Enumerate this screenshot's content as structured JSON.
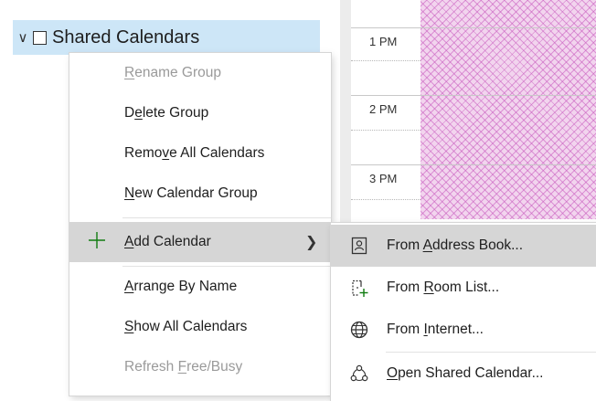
{
  "group": {
    "label": "Shared Calendars"
  },
  "times": [
    "1 PM",
    "2 PM",
    "3 PM"
  ],
  "menu": {
    "items": [
      {
        "pre": "",
        "u": "R",
        "post": "ename Group",
        "disabled": true
      },
      {
        "pre": "D",
        "u": "e",
        "post": "lete Group",
        "disabled": false
      },
      {
        "pre": "Remo",
        "u": "v",
        "post": "e All Calendars",
        "disabled": false
      },
      {
        "pre": "",
        "u": "N",
        "post": "ew Calendar Group",
        "disabled": false
      },
      {
        "pre": "",
        "u": "A",
        "post": "dd Calendar",
        "disabled": false
      },
      {
        "pre": "",
        "u": "A",
        "post": "rrange By Name",
        "disabled": false
      },
      {
        "pre": "",
        "u": "S",
        "post": "how All Calendars",
        "disabled": false
      },
      {
        "pre": "Refresh ",
        "u": "F",
        "post": "ree/Busy",
        "disabled": true
      }
    ]
  },
  "submenu": {
    "items": [
      {
        "pre": "From ",
        "u": "A",
        "post": "ddress Book..."
      },
      {
        "pre": "From ",
        "u": "R",
        "post": "oom List..."
      },
      {
        "pre": "From ",
        "u": "I",
        "post": "nternet..."
      },
      {
        "pre": "",
        "u": "O",
        "post": "pen Shared Calendar..."
      }
    ]
  },
  "colors": {
    "accent_green": "#107c10",
    "highlight": "#d6d6d6",
    "selected_group": "#cde6f7",
    "busy_pattern": "#c85abe"
  },
  "icons": {
    "expand": "chevron-down-icon",
    "add": "plus-icon",
    "submenu_arrow": "chevron-right-icon",
    "address_book": "address-book-icon",
    "room_list": "room-list-icon",
    "internet": "globe-icon",
    "open_shared": "shared-calendar-icon"
  }
}
